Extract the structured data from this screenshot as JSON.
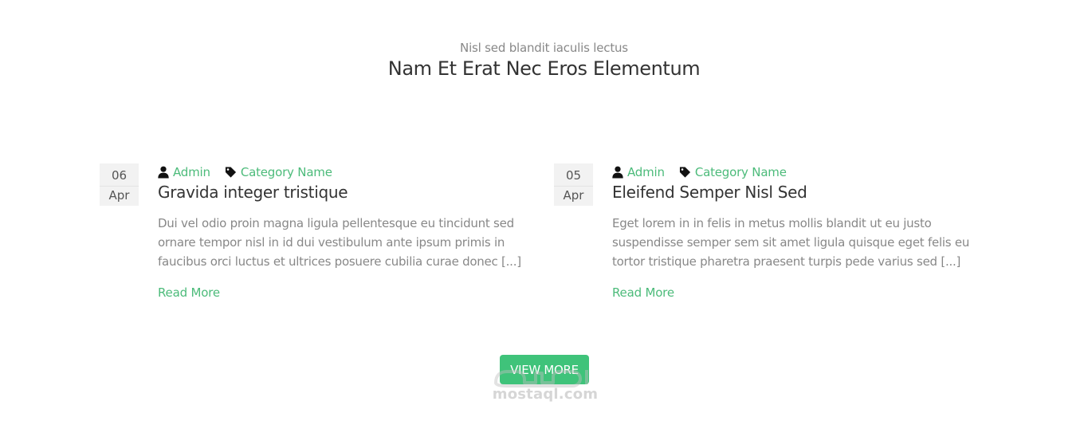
{
  "header": {
    "subtitle": "Nisl sed blandit iaculis lectus",
    "title": "Nam Et Erat Nec Eros Elementum"
  },
  "posts": [
    {
      "day": "06",
      "month": "Apr",
      "author": "Admin",
      "category": "Category Name",
      "title": "Gravida integer tristique",
      "excerpt_lines": [
        "Dui vel odio proin magna ligula pellentesque eu tincidunt sed",
        "ornare tempor nisl in id dui vestibulum ante ipsum primis in",
        "faucibus orci luctus et ultrices posuere cubilia curae donec [...]"
      ],
      "read_more": "Read More"
    },
    {
      "day": "05",
      "month": "Apr",
      "author": "Admin",
      "category": "Category Name",
      "title": "Eleifend Semper Nisl Sed",
      "excerpt_lines": [
        "Eget lorem in in felis in metus mollis blandit ut eu justo",
        "suspendisse semper sem sit amet ligula quisque eget felis eu",
        "tortor tristique pharetra praesent turpis pede varius sed [...]"
      ],
      "read_more": "Read More"
    }
  ],
  "view_more_label": "VIEW MORE",
  "watermark": {
    "text": "mostaql.com"
  },
  "colors": {
    "accent": "#4cbb7a",
    "button": "#3fc37a",
    "title": "#333333",
    "muted": "#888888",
    "date_bg": "#f2f2f2"
  },
  "icons": {
    "author": "user-icon",
    "category": "tag-icon"
  }
}
